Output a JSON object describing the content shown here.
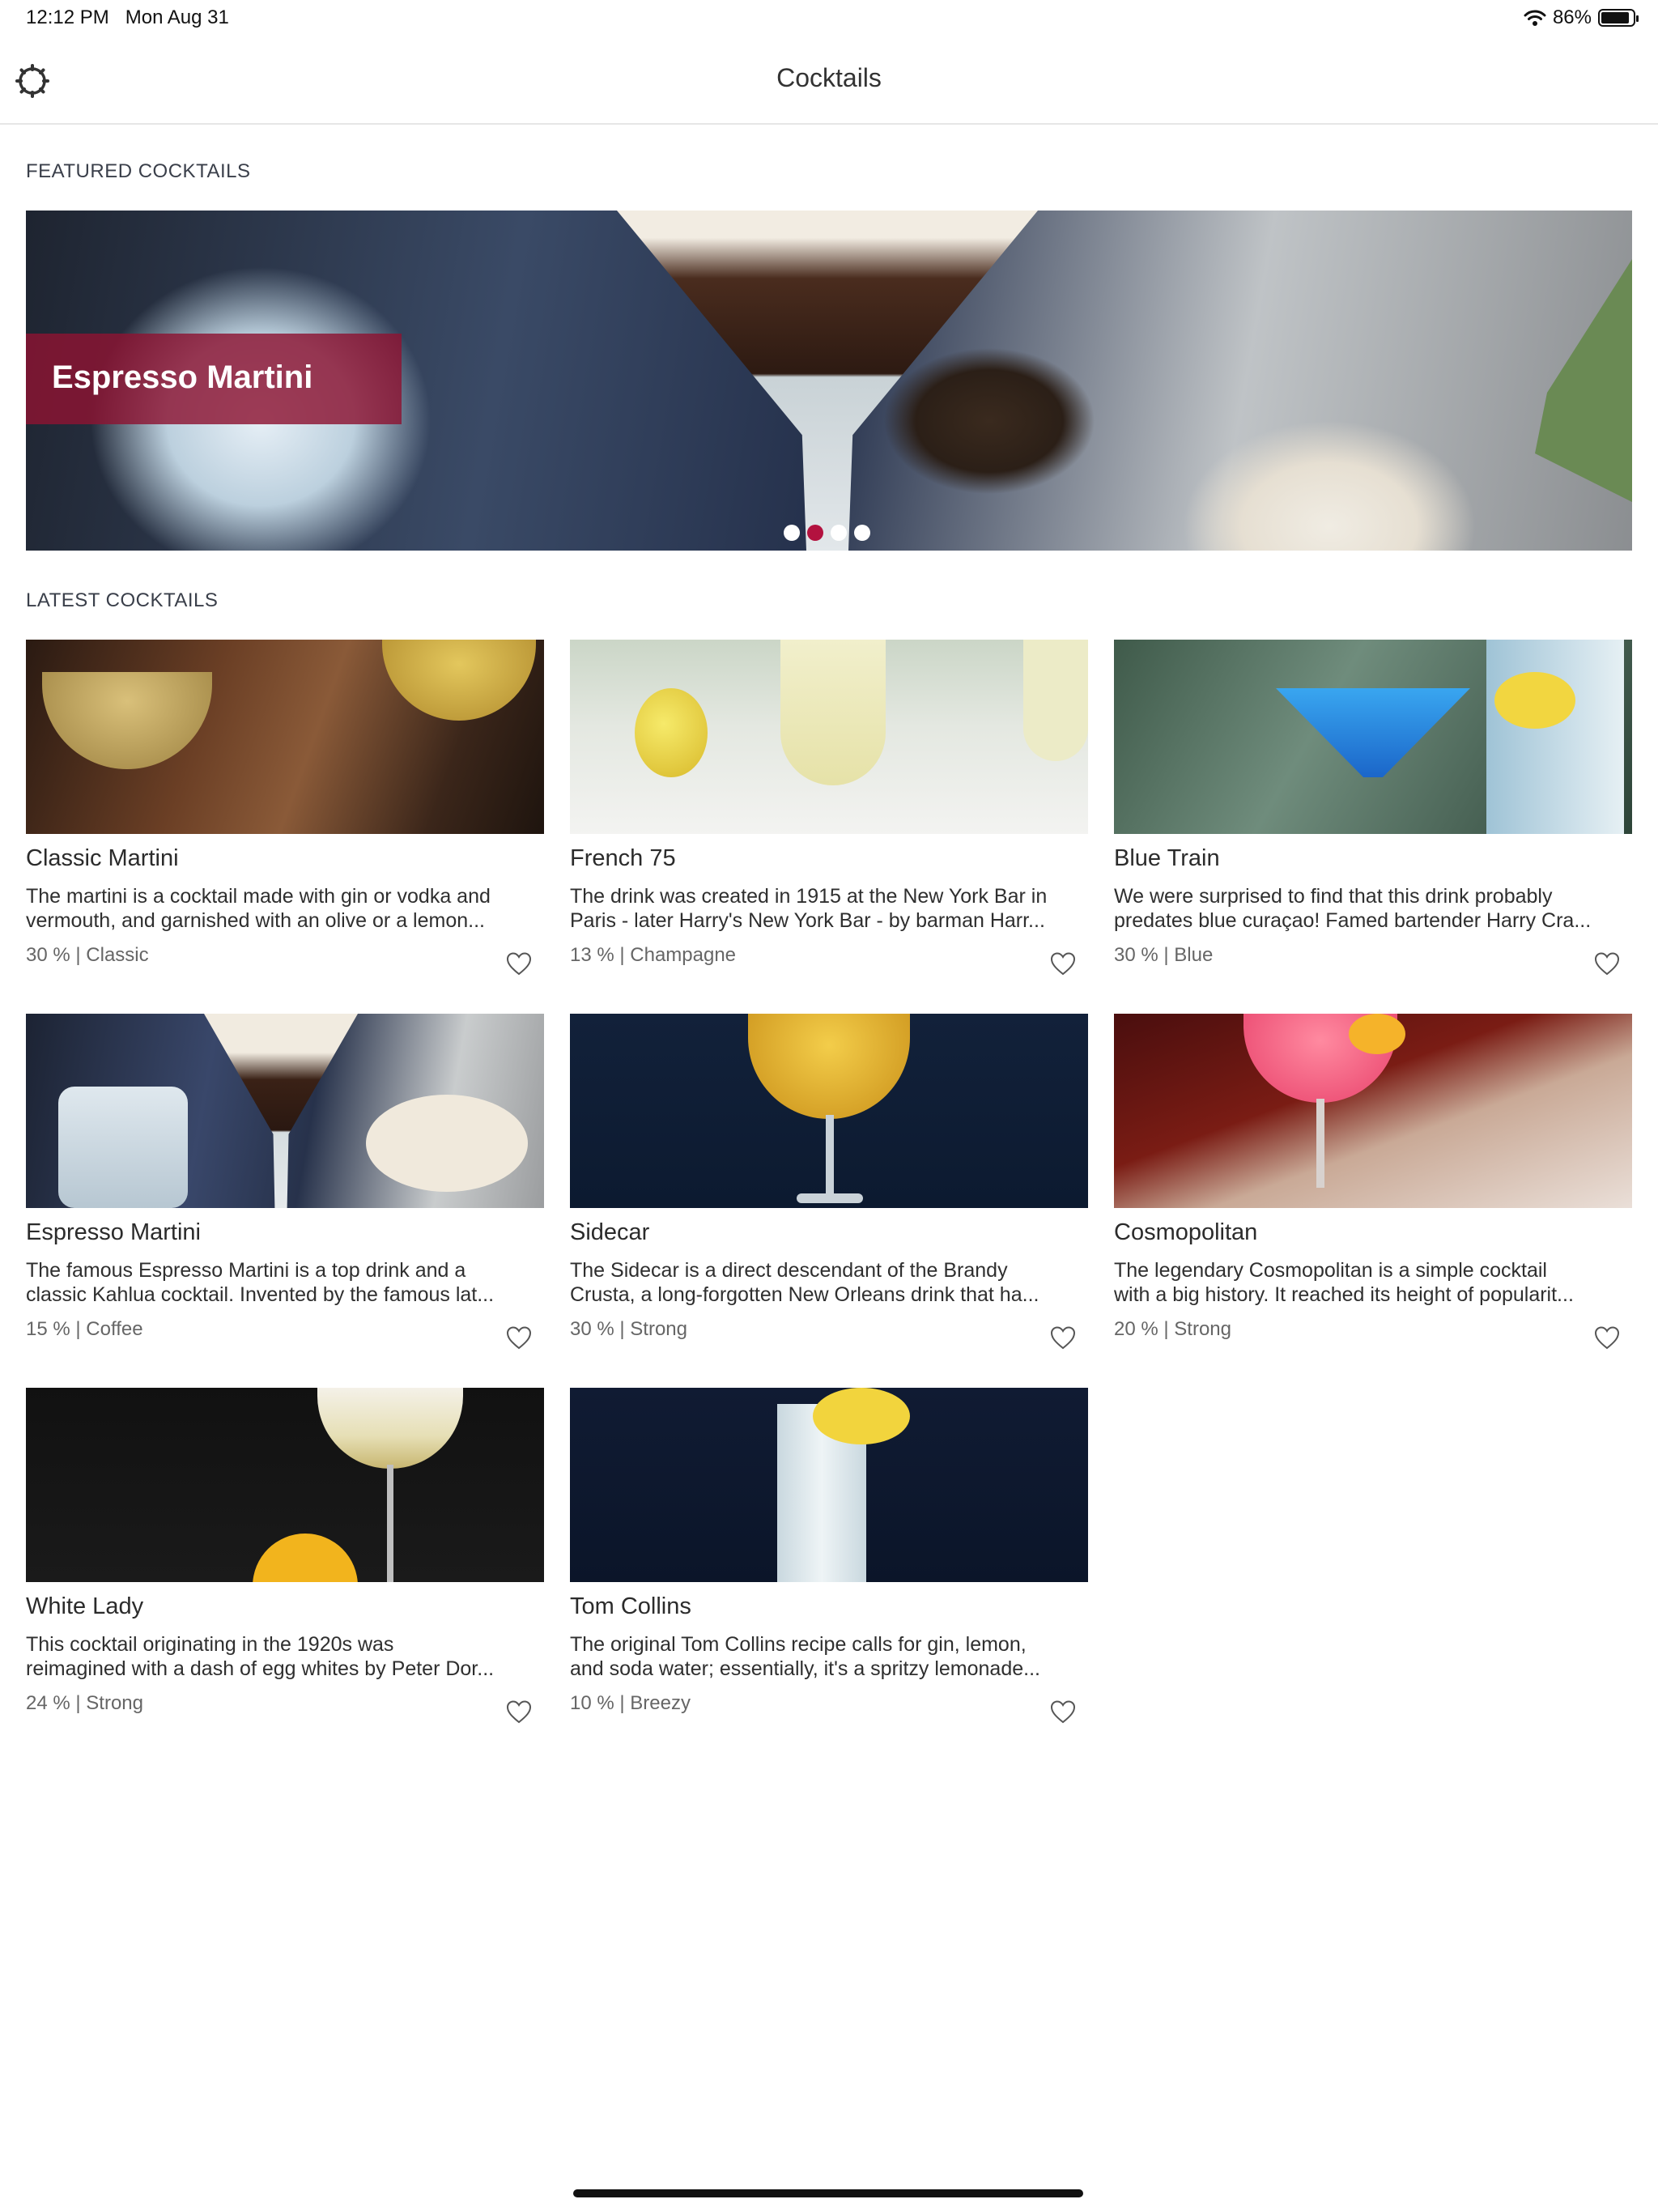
{
  "status_bar": {
    "time": "12:12 PM",
    "date": "Mon Aug 31",
    "battery": "86%"
  },
  "nav": {
    "title": "Cocktails",
    "settings_icon": "gear-icon"
  },
  "featured": {
    "heading": "FEATURED COCKTAILS",
    "title": "Espresso Martini",
    "pages": 4,
    "active_page": 2
  },
  "latest": {
    "heading": "LATEST COCKTAILS",
    "items": [
      {
        "name": "Classic Martini",
        "line1": "The martini is a cocktail made with gin or vodka and",
        "line2": "vermouth, and garnished with an olive or a lemon...",
        "meta": "30 % | Classic"
      },
      {
        "name": "French 75",
        "line1": "The drink was created in 1915 at the New York Bar in",
        "line2": "Paris - later Harry's New York Bar - by barman Harr...",
        "meta": "13 % | Champagne"
      },
      {
        "name": "Blue Train",
        "line1": "We were surprised to find that this drink probably",
        "line2": "predates blue curaçao! Famed bartender Harry Cra...",
        "meta": "30 % | Blue"
      },
      {
        "name": "Espresso Martini",
        "line1": "The famous Espresso Martini is a top drink and a",
        "line2": "classic Kahlua cocktail. Invented by the famous lat...",
        "meta": "15 % | Coffee"
      },
      {
        "name": "Sidecar",
        "line1": "The Sidecar is a direct descendant of the Brandy",
        "line2": "Crusta, a long-forgotten New Orleans drink that ha...",
        "meta": "30 % | Strong"
      },
      {
        "name": "Cosmopolitan",
        "line1": "The legendary Cosmopolitan is a simple cocktail",
        "line2": "with a big history. It reached its height of popularit...",
        "meta": "20 % | Strong"
      },
      {
        "name": "White Lady",
        "line1": "This cocktail originating in the 1920s was",
        "line2": "reimagined with a dash of egg whites by Peter Dor...",
        "meta": "24 % | Strong"
      },
      {
        "name": "Tom Collins",
        "line1": "The original Tom Collins recipe calls for gin, lemon,",
        "line2": "and soda water; essentially, it's a spritzy lemonade...",
        "meta": "10 % | Breezy"
      }
    ]
  },
  "colors": {
    "accent": "#b3123f",
    "banner": "#8c1432"
  }
}
